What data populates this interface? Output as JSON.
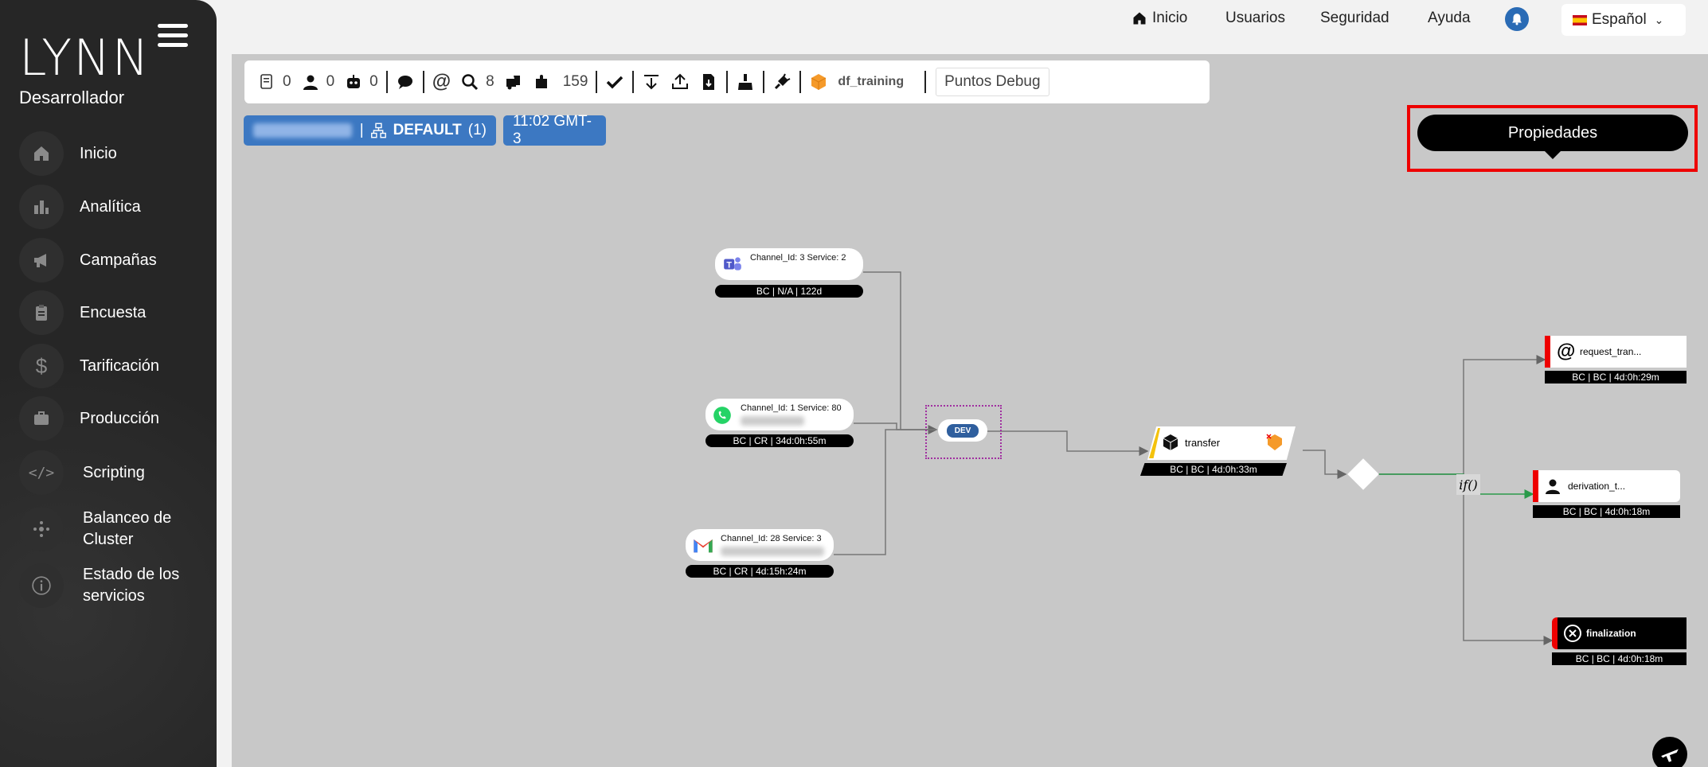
{
  "app": {
    "logo": "LYNN",
    "role": "Desarrollador"
  },
  "sidebar": {
    "items": [
      {
        "label": "Inicio"
      },
      {
        "label": "Analítica"
      },
      {
        "label": "Campañas"
      },
      {
        "label": "Encuesta"
      },
      {
        "label": "Tarificación"
      },
      {
        "label": "Producción"
      },
      {
        "label": "Scripting"
      },
      {
        "label": "Balanceo de Cluster"
      },
      {
        "label": "Estado de los servicios"
      }
    ]
  },
  "topnav": {
    "home": "Inicio",
    "users": "Usuarios",
    "security": "Seguridad",
    "help": "Ayuda",
    "language": "Español"
  },
  "toolbar": {
    "counts": {
      "a": "0",
      "b": "0",
      "c": "0",
      "search": "8",
      "puzzle": "159"
    },
    "project": "df_training",
    "debug": "Puntos Debug"
  },
  "chips": {
    "group_name": "DEFAULT",
    "group_count": "(1)",
    "time": "11:02 GMT-3"
  },
  "properties": "Propiedades",
  "nodes": {
    "teams": {
      "title": "Channel_Id: 3 Service: 2",
      "foot": "BC | N/A | 122d"
    },
    "whatsapp": {
      "title": "Channel_Id: 1 Service: 80",
      "foot": "BC | CR | 34d:0h:55m"
    },
    "gmail": {
      "title": "Channel_Id: 28 Service: 3",
      "foot": "BC | CR | 4d:15h:24m"
    },
    "dev": {
      "label": "DEV"
    },
    "transfer": {
      "label": "transfer",
      "foot": "BC | BC | 4d:0h:33m"
    },
    "request": {
      "label": "request_tran...",
      "foot": "BC | BC | 4d:0h:29m"
    },
    "derivation": {
      "label": "derivation_t...",
      "foot": "BC | BC | 4d:0h:18m"
    },
    "finalization": {
      "label": "finalization",
      "foot": "BC | BC | 4d:0h:18m"
    },
    "if": {
      "label": "if()"
    }
  },
  "colors": {
    "accent": "#3c78c2",
    "sidebar": "#262626",
    "canvas": "#c8c8c8",
    "highlight": "#e00000"
  }
}
